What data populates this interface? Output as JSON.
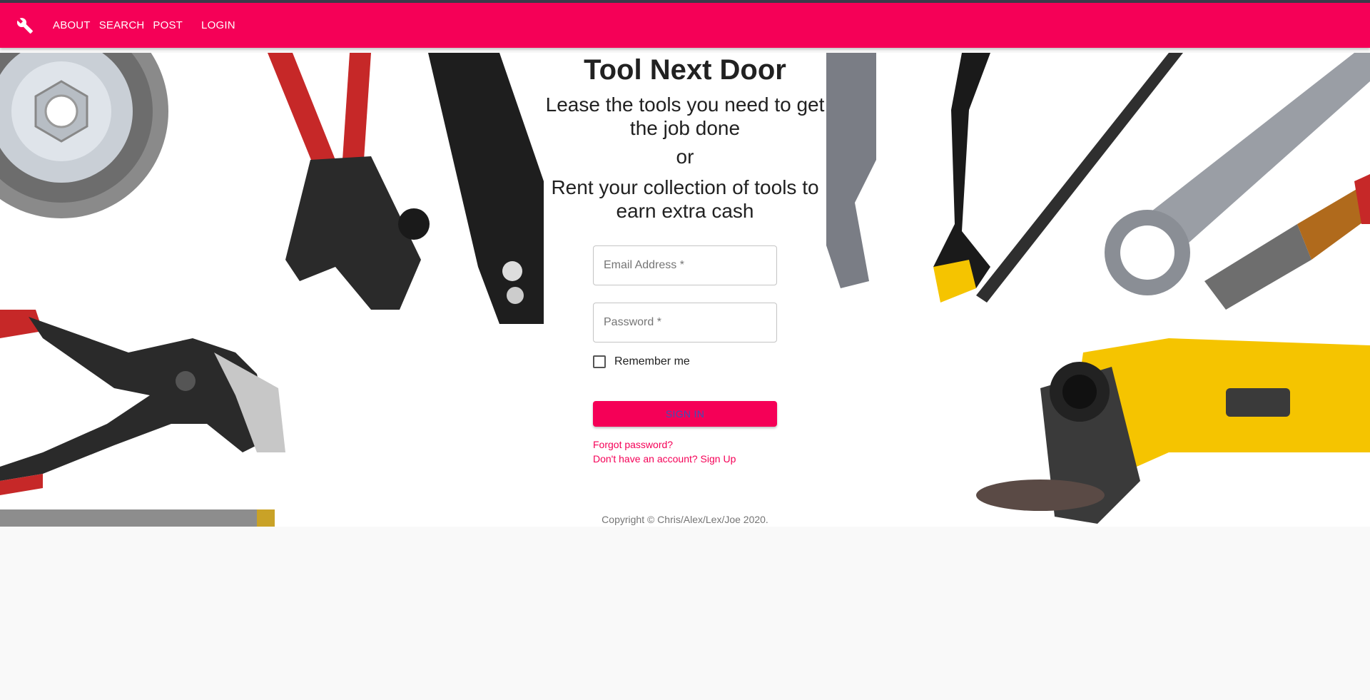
{
  "nav": {
    "logo_icon": "wrench-icon",
    "items": [
      "ABOUT",
      "SEARCH",
      "POST",
      "LOGIN"
    ]
  },
  "hero": {
    "title": "Tool Next Door",
    "subtitle_1": "Lease the tools you need to get the job done",
    "or": "or",
    "subtitle_2": "Rent your collection of tools to earn extra cash"
  },
  "form": {
    "email_placeholder": "Email Address *",
    "password_placeholder": "Password *",
    "remember_label": "Remember me",
    "signin_label": "SIGN IN",
    "forgot_link": "Forgot password?",
    "signup_link": "Don't have an account? Sign Up"
  },
  "footer": {
    "copyright": "Copyright © Chris/Alex/Lex/Joe 2020."
  },
  "colors": {
    "accent": "#f50057",
    "button_text": "#3f51b5"
  }
}
